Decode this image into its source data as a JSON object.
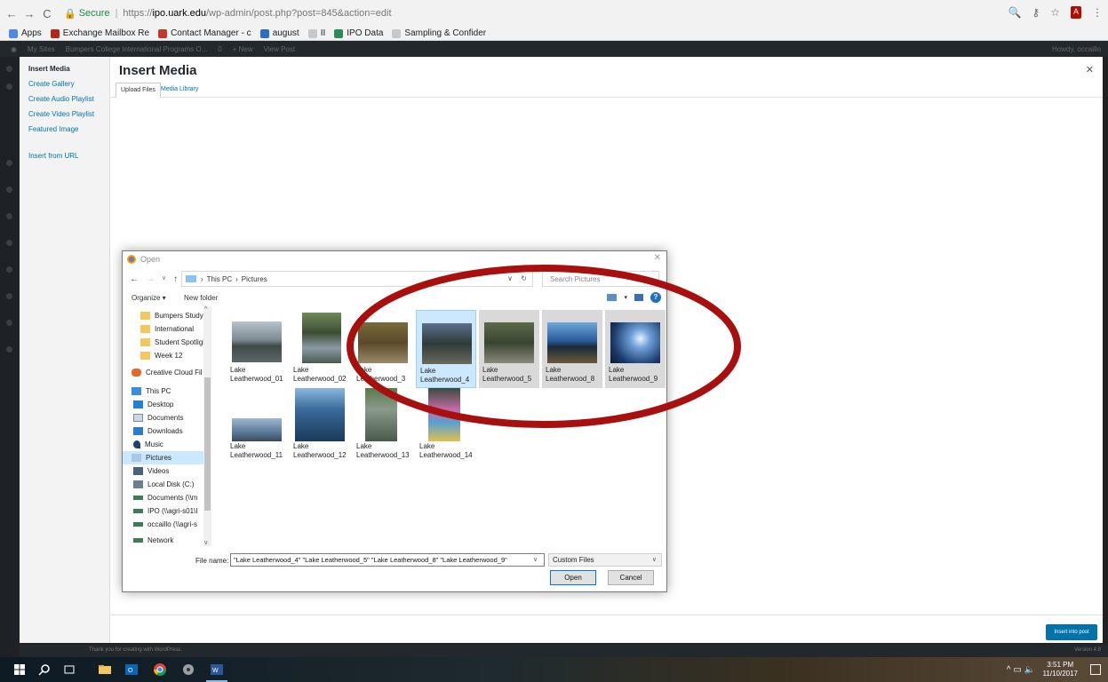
{
  "browser": {
    "secure_label": "Secure",
    "url_scheme": "https://",
    "url_host": "ipo.uark.edu",
    "url_path": "/wp-admin/post.php?post=845&action=edit",
    "bookmarks": [
      {
        "label": "Apps",
        "color": "#4f88e8"
      },
      {
        "label": "Exchange Mailbox Re",
        "color": "#b3261e"
      },
      {
        "label": "Contact Manager - c",
        "color": "#c0392b"
      },
      {
        "label": "august",
        "color": "#2e6bc7"
      },
      {
        "label": "II",
        "color": "#c8c8c8"
      },
      {
        "label": "IPO Data",
        "color": "#2e8b57"
      },
      {
        "label": "Sampling & Confider",
        "color": "#c8c8c8"
      }
    ]
  },
  "adminbar": {
    "items": [
      "My Sites",
      "Bumpers College International Programs O...",
      "0",
      "+ New",
      "View Post"
    ],
    "howdy": "Howdy, occaillo"
  },
  "modal": {
    "title": "Insert Media",
    "close_icon": "close-icon",
    "menu": [
      "Insert Media",
      "Create Gallery",
      "Create Audio Playlist",
      "Create Video Playlist",
      "Featured Image",
      "Insert from URL"
    ],
    "tabs": [
      "Upload Files",
      "Media Library"
    ],
    "insert_button": "Insert into post"
  },
  "wp_footer": {
    "thanks": "Thank you for creating with WordPress.",
    "version": "Version 4.8"
  },
  "dialog": {
    "title": "Open",
    "breadcrumb": [
      "This PC",
      "Pictures"
    ],
    "search_placeholder": "Search Pictures",
    "organize": "Organize ▾",
    "new_folder": "New folder",
    "nav": [
      {
        "label": "Bumpers Study A",
        "icon": "folder"
      },
      {
        "label": "International",
        "icon": "folder"
      },
      {
        "label": "Student Spotligh",
        "icon": "folder"
      },
      {
        "label": "Week 12",
        "icon": "folder"
      },
      {
        "label": "Creative Cloud Fil",
        "icon": "cloud"
      },
      {
        "label": "This PC",
        "icon": "pc"
      },
      {
        "label": "Desktop",
        "icon": "desk"
      },
      {
        "label": "Documents",
        "icon": "doc"
      },
      {
        "label": "Downloads",
        "icon": "down"
      },
      {
        "label": "Music",
        "icon": "music"
      },
      {
        "label": "Pictures",
        "icon": "pics"
      },
      {
        "label": "Videos",
        "icon": "vid"
      },
      {
        "label": "Local Disk (C:)",
        "icon": "disk"
      },
      {
        "label": "Documents (\\\\m",
        "icon": "net"
      },
      {
        "label": "IPO (\\\\agri-s01\\I",
        "icon": "net"
      },
      {
        "label": "occaillo (\\\\agri-s",
        "icon": "net"
      },
      {
        "label": "Network",
        "icon": "net"
      }
    ],
    "files": [
      {
        "line1": "Lake",
        "line2": "Leatherwood_01",
        "state": "normal"
      },
      {
        "line1": "Lake",
        "line2": "Leatherwood_02",
        "state": "normal"
      },
      {
        "line1": "Lake",
        "line2": "Leatherwood_3",
        "state": "normal"
      },
      {
        "line1": "Lake",
        "line2": "Leatherwood_4",
        "state": "selected"
      },
      {
        "line1": "Lake",
        "line2": "Leatherwood_5",
        "state": "highlighted"
      },
      {
        "line1": "Lake",
        "line2": "Leatherwood_8",
        "state": "highlighted"
      },
      {
        "line1": "Lake",
        "line2": "Leatherwood_9",
        "state": "highlighted"
      },
      {
        "line1": "Lake",
        "line2": "Leatherwood_11",
        "state": "normal"
      },
      {
        "line1": "Lake",
        "line2": "Leatherwood_12",
        "state": "normal"
      },
      {
        "line1": "Lake",
        "line2": "Leatherwood_13",
        "state": "normal"
      },
      {
        "line1": "Lake",
        "line2": "Leatherwood_14",
        "state": "normal"
      }
    ],
    "file_name_label": "File name:",
    "file_name_value": "\"Lake Leatherwood_4\" \"Lake Leatherwood_5\" \"Lake Leatherwood_8\" \"Lake Leatherwood_9\"",
    "file_type": "Custom Files",
    "open_button": "Open",
    "cancel_button": "Cancel"
  },
  "taskbar": {
    "time": "3:51 PM",
    "date": "11/10/2017"
  },
  "colors": {
    "annotation_ellipse": "#a81010",
    "wp_blue": "#0073aa",
    "selected_tile": "#cce8ff"
  }
}
